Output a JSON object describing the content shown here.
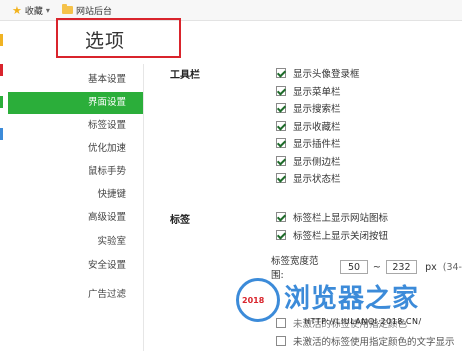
{
  "bookmarks": {
    "favorites_label": "收藏",
    "folder_label": "网站后台"
  },
  "page": {
    "title": "选项"
  },
  "sidebar": {
    "items": [
      {
        "label": "基本设置",
        "active": false
      },
      {
        "label": "界面设置",
        "active": true
      },
      {
        "label": "标签设置",
        "active": false
      },
      {
        "label": "优化加速",
        "active": false
      },
      {
        "label": "鼠标手势",
        "active": false
      },
      {
        "label": "快捷键",
        "active": false
      },
      {
        "label": "高级设置",
        "active": false
      },
      {
        "label": "实验室",
        "active": false
      },
      {
        "label": "安全设置",
        "active": false
      },
      {
        "label": "广告过滤",
        "active": false
      }
    ]
  },
  "toolbar_section": {
    "label": "工具栏",
    "options": [
      {
        "label": "显示头像登录框",
        "checked": true
      },
      {
        "label": "显示菜单栏",
        "checked": true
      },
      {
        "label": "显示搜索栏",
        "checked": true
      },
      {
        "label": "显示收藏栏",
        "checked": true
      },
      {
        "label": "显示插件栏",
        "checked": true
      },
      {
        "label": "显示侧边栏",
        "checked": true
      },
      {
        "label": "显示状态栏",
        "checked": true
      }
    ]
  },
  "tabs_section": {
    "label": "标签",
    "options": [
      {
        "label": "标签栏上显示网站图标",
        "checked": true
      },
      {
        "label": "标签栏上显示关闭按钮",
        "checked": true
      }
    ],
    "width_range": {
      "label": "标签宽度范围:",
      "min": "50",
      "separator": "~",
      "max": "232",
      "unit": "px",
      "hint": "(34-"
    },
    "partial_options": [
      {
        "label": "未激活的标签使用指定颜色",
        "checked": false
      },
      {
        "label": "未激活的标签使用指定颜色的文字显示",
        "checked": false
      }
    ]
  },
  "watermark": {
    "text": "浏览器之家",
    "year": "2018",
    "url": "HTTP://LIULANQI.2018.CN/"
  },
  "colors": {
    "accent_green": "#2bae3a",
    "highlight_red": "#d9242c",
    "watermark_blue": "#3c8bd9"
  }
}
